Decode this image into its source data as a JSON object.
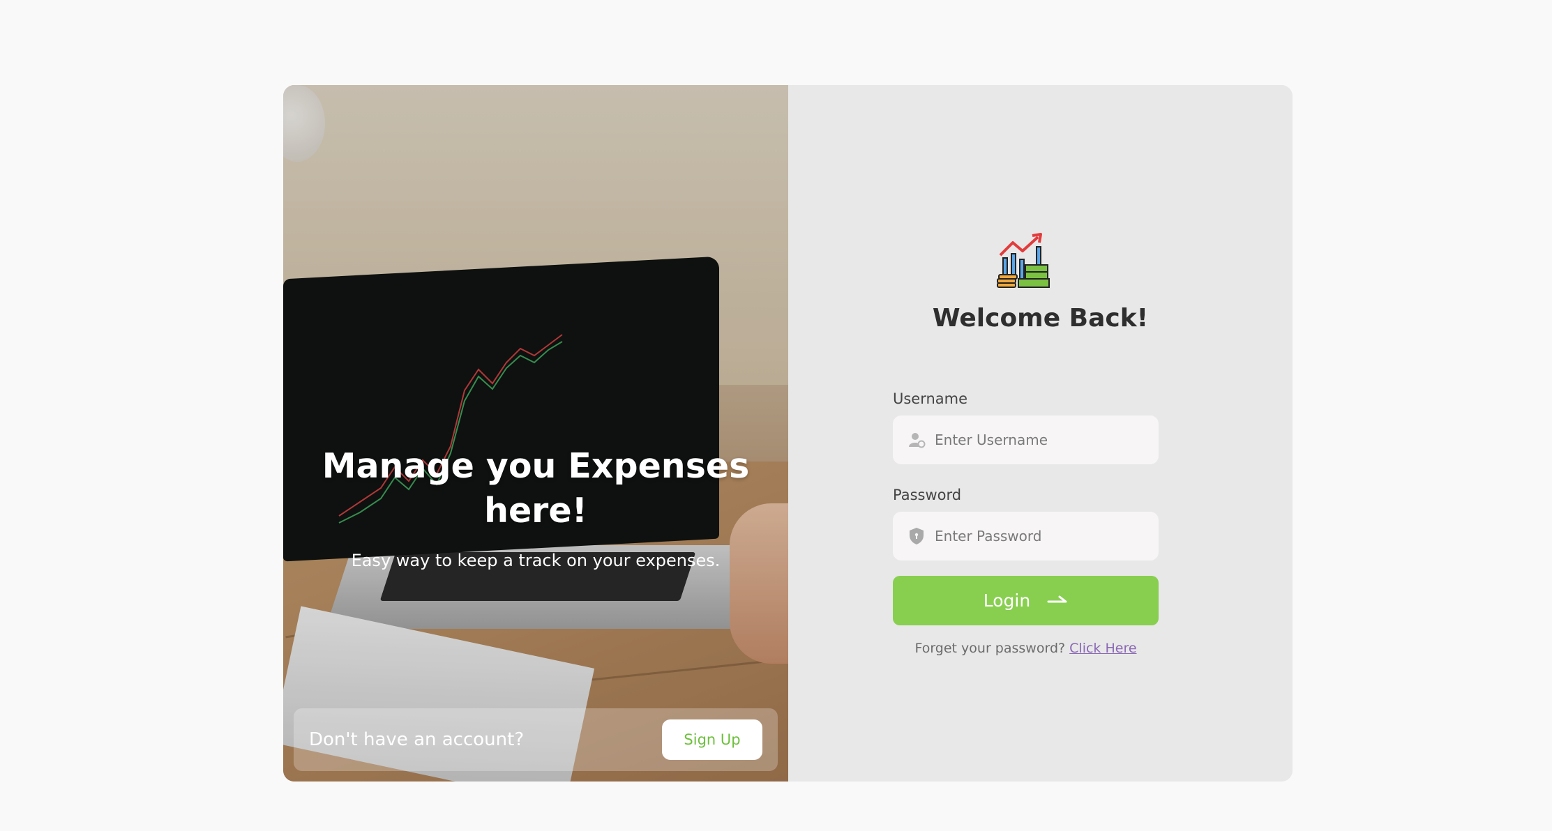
{
  "hero": {
    "title_line1": "Manage you Expenses",
    "title_line2": "here!",
    "subtitle": "Easy way to keep a track on your expenses.",
    "signup_prompt": "Don't have an account?",
    "signup_label": "Sign Up"
  },
  "form": {
    "logo_icon": "finance-growth-icon",
    "heading": "Welcome Back!",
    "username": {
      "label": "Username",
      "placeholder": "Enter Username",
      "icon": "user-icon"
    },
    "password": {
      "label": "Password",
      "placeholder": "Enter Password",
      "icon": "shield-icon"
    },
    "login_label": "Login",
    "login_icon": "arrow-right-icon",
    "forgot_text": "Forget your password?",
    "forgot_link": "Click Here"
  },
  "colors": {
    "accent": "#88cf50",
    "link": "#8a68b5",
    "panel_bg": "#e8e8e8",
    "page_bg": "#f9f9f9"
  }
}
